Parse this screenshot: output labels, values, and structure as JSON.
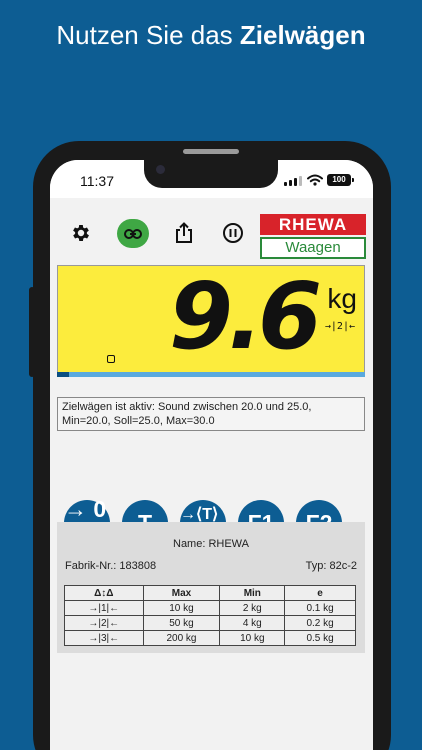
{
  "headline": {
    "prefix": "Nutzen Sie das ",
    "emphasis": "Zielwägen"
  },
  "status_bar": {
    "time": "11:37",
    "battery": "100",
    "signal_icon": "signal-icon",
    "wifi_icon": "wifi-icon"
  },
  "toolbar": {
    "settings_icon": "gear-icon",
    "link_icon": "link-icon",
    "share_icon": "share-icon",
    "pause_icon": "pause-icon"
  },
  "logo": {
    "top": "RHEWA",
    "bottom": "Waagen",
    "colors": {
      "red": "#d8232a",
      "green": "#2a8a3a"
    }
  },
  "display": {
    "value": "9.6",
    "unit": "kg",
    "range_indicator": "→|2|←",
    "zero_indicator_icon": "zero-indicator-icon",
    "progress_fraction": 0.04,
    "background": "#fcec3d"
  },
  "info_text": "Zielwägen ist aktiv: Sound zwischen 20.0 und 25.0, Min=20.0, Soll=25.0, Max=30.0",
  "keys": [
    {
      "name": "zero-key",
      "label": "→ 0 ←"
    },
    {
      "name": "tare-key",
      "label": "→T←"
    },
    {
      "name": "preset-tare-key",
      "label": "→⟨T⟩←"
    },
    {
      "name": "f1-key",
      "label": "F1"
    },
    {
      "name": "f2-key",
      "label": "F2"
    }
  ],
  "plate": {
    "name": "Name: RHEWA",
    "fabrik": "Fabrik-Nr.: 183808",
    "typ": "Typ: 82c-2",
    "headers": [
      "Δ↕Δ",
      "Max",
      "Min",
      "e"
    ],
    "rows": [
      [
        "→|1|←",
        "10 kg",
        "2 kg",
        "0.1 kg"
      ],
      [
        "→|2|←",
        "50 kg",
        "4 kg",
        "0.2 kg"
      ],
      [
        "→|3|←",
        "200 kg",
        "10 kg",
        "0.5 kg"
      ]
    ]
  },
  "colors": {
    "background": "#0d5d93",
    "link_active": "#3fa744",
    "key": "#0d5d93"
  }
}
